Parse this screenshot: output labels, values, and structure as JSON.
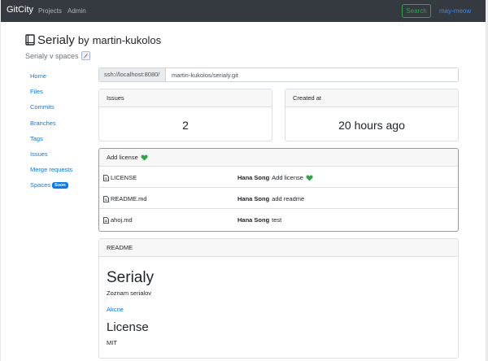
{
  "navbar": {
    "brand": "GitCity",
    "links": [
      "Projects",
      "Admin"
    ],
    "search_label": "Search",
    "user": "may-meow"
  },
  "repo": {
    "name": "Serialy",
    "by": "by",
    "owner": "martin-kukolos",
    "subtitle": "Serialy v spaces"
  },
  "sidebar": {
    "items": [
      {
        "label": "Home"
      },
      {
        "label": "Files"
      },
      {
        "label": "Commits"
      },
      {
        "label": "Branches"
      },
      {
        "label": "Tags"
      },
      {
        "label": "Issues"
      },
      {
        "label": "Merge requests"
      },
      {
        "label": "Spaces",
        "badge": "Soon"
      }
    ]
  },
  "clone": {
    "prefix": "ssh://localhost:8080/",
    "value": "martin-kukolos/serialy.git"
  },
  "stats": {
    "issues_label": "Issues",
    "issues_value": "2",
    "created_label": "Created at",
    "created_value": "20 hours ago"
  },
  "commit": {
    "header": "Add license",
    "files": [
      {
        "name": "LICENSE",
        "author": "Hana Song",
        "message": "Add license",
        "heart": true
      },
      {
        "name": "README.md",
        "author": "Hana Song",
        "message": "add readme",
        "heart": false
      },
      {
        "name": "ahoj.md",
        "author": "Hana Song",
        "message": "test",
        "heart": false
      }
    ]
  },
  "readme": {
    "header": "README",
    "title": "Serialy",
    "text": "Zoznam serialov",
    "link": "Akcne",
    "license_title": "License",
    "license_text": "MIT"
  },
  "colors": {
    "navbar_bg": "#343a40",
    "link": "#007bff",
    "search_btn": "#28a745",
    "heart": "#28a745"
  },
  "icons": {
    "repo": "book-icon",
    "spaces": "rocket-icon",
    "file": "file-icon",
    "commit_mark": "green-heart-icon"
  }
}
